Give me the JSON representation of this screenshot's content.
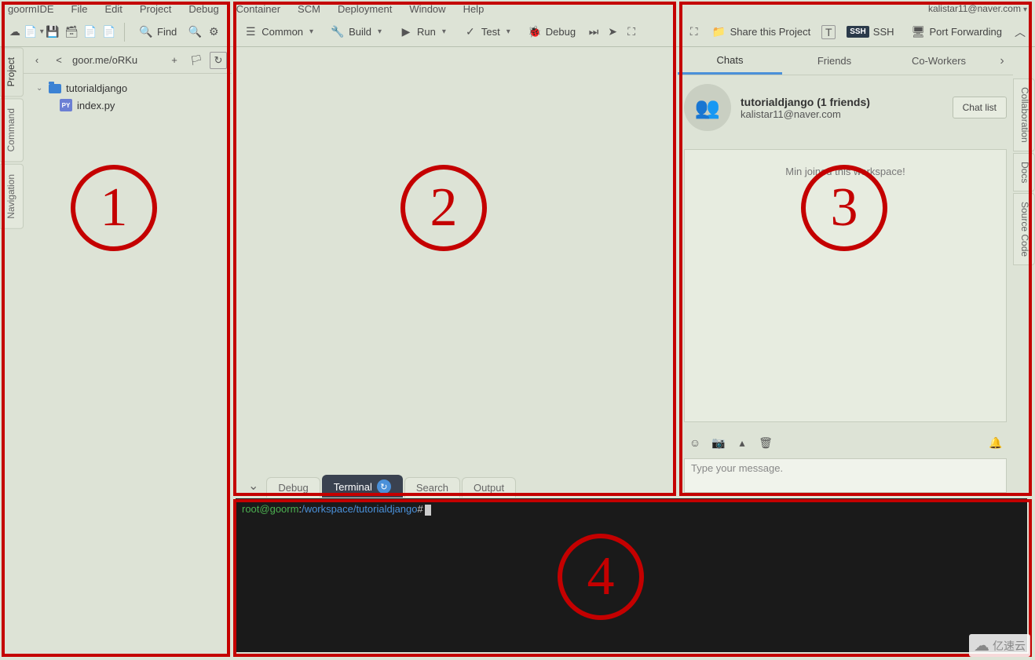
{
  "menu": {
    "app": "goormIDE",
    "items": [
      "File",
      "Edit",
      "Project",
      "Debug",
      "Container",
      "SCM",
      "Deployment",
      "Window",
      "Help"
    ],
    "user": "kalistar11@naver.com"
  },
  "toolbar": {
    "find": "Find",
    "common": "Common",
    "build": "Build",
    "run": "Run",
    "test": "Test",
    "debug": "Debug",
    "share": "Share this Project",
    "ssh": "SSH",
    "port": "Port Forwarding"
  },
  "project": {
    "url": "goor.me/oRKu",
    "folder": "tutorialdjango",
    "file": "index.py"
  },
  "left_tabs": [
    "Project",
    "Command",
    "Navigation"
  ],
  "bottom_tabs": {
    "debug": "Debug",
    "terminal": "Terminal",
    "search": "Search",
    "output": "Output"
  },
  "terminal": {
    "user": "root@goorm",
    "path": "/workspace/tutorialdjango",
    "prompt": "#"
  },
  "chat": {
    "tabs": [
      "Chats",
      "Friends",
      "Co-Workers"
    ],
    "name": "tutorialdjango (1 friends)",
    "email": "kalistar11@naver.com",
    "chatlist": "Chat list",
    "status": "Min joined this workspace!",
    "placeholder": "Type your message."
  },
  "right_side_tabs": [
    "Collaboration",
    "Docs",
    "Source Code"
  ],
  "annotations": [
    "1",
    "2",
    "3",
    "4"
  ],
  "watermark": "亿速云"
}
